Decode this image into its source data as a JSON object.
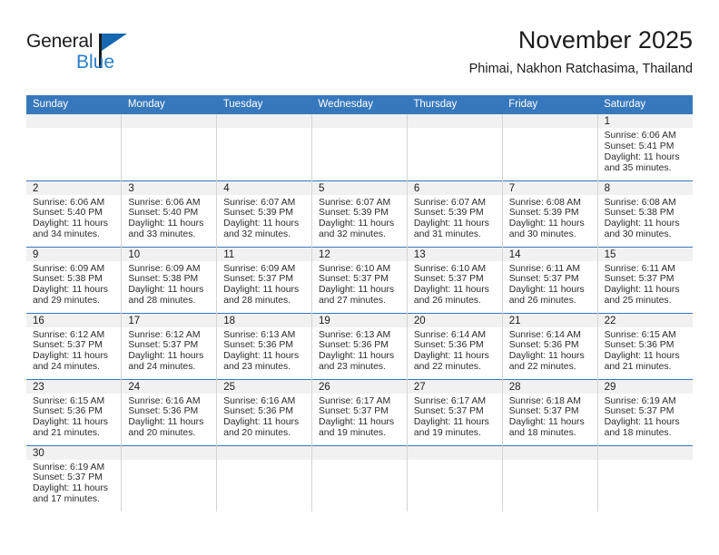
{
  "brand": {
    "name_top": "General",
    "name_bottom": "Blue",
    "accent_color": "#2a7fc9",
    "flag_color": "#1667b2"
  },
  "header": {
    "title": "November 2025",
    "subtitle": "Phimai, Nakhon Ratchasima, Thailand"
  },
  "theme": {
    "header_row_bg": "#3778bc",
    "daynum_bg": "#f1f1f1",
    "row_divider": "#3778bc",
    "col_divider": "#d4d4d4"
  },
  "weekdays": [
    "Sunday",
    "Monday",
    "Tuesday",
    "Wednesday",
    "Thursday",
    "Friday",
    "Saturday"
  ],
  "weeks": [
    [
      {
        "day": "",
        "lines": []
      },
      {
        "day": "",
        "lines": []
      },
      {
        "day": "",
        "lines": []
      },
      {
        "day": "",
        "lines": []
      },
      {
        "day": "",
        "lines": []
      },
      {
        "day": "",
        "lines": []
      },
      {
        "day": "1",
        "lines": [
          "Sunrise: 6:06 AM",
          "Sunset: 5:41 PM",
          "Daylight: 11 hours",
          "and 35 minutes."
        ]
      }
    ],
    [
      {
        "day": "2",
        "lines": [
          "Sunrise: 6:06 AM",
          "Sunset: 5:40 PM",
          "Daylight: 11 hours",
          "and 34 minutes."
        ]
      },
      {
        "day": "3",
        "lines": [
          "Sunrise: 6:06 AM",
          "Sunset: 5:40 PM",
          "Daylight: 11 hours",
          "and 33 minutes."
        ]
      },
      {
        "day": "4",
        "lines": [
          "Sunrise: 6:07 AM",
          "Sunset: 5:39 PM",
          "Daylight: 11 hours",
          "and 32 minutes."
        ]
      },
      {
        "day": "5",
        "lines": [
          "Sunrise: 6:07 AM",
          "Sunset: 5:39 PM",
          "Daylight: 11 hours",
          "and 32 minutes."
        ]
      },
      {
        "day": "6",
        "lines": [
          "Sunrise: 6:07 AM",
          "Sunset: 5:39 PM",
          "Daylight: 11 hours",
          "and 31 minutes."
        ]
      },
      {
        "day": "7",
        "lines": [
          "Sunrise: 6:08 AM",
          "Sunset: 5:39 PM",
          "Daylight: 11 hours",
          "and 30 minutes."
        ]
      },
      {
        "day": "8",
        "lines": [
          "Sunrise: 6:08 AM",
          "Sunset: 5:38 PM",
          "Daylight: 11 hours",
          "and 30 minutes."
        ]
      }
    ],
    [
      {
        "day": "9",
        "lines": [
          "Sunrise: 6:09 AM",
          "Sunset: 5:38 PM",
          "Daylight: 11 hours",
          "and 29 minutes."
        ]
      },
      {
        "day": "10",
        "lines": [
          "Sunrise: 6:09 AM",
          "Sunset: 5:38 PM",
          "Daylight: 11 hours",
          "and 28 minutes."
        ]
      },
      {
        "day": "11",
        "lines": [
          "Sunrise: 6:09 AM",
          "Sunset: 5:37 PM",
          "Daylight: 11 hours",
          "and 28 minutes."
        ]
      },
      {
        "day": "12",
        "lines": [
          "Sunrise: 6:10 AM",
          "Sunset: 5:37 PM",
          "Daylight: 11 hours",
          "and 27 minutes."
        ]
      },
      {
        "day": "13",
        "lines": [
          "Sunrise: 6:10 AM",
          "Sunset: 5:37 PM",
          "Daylight: 11 hours",
          "and 26 minutes."
        ]
      },
      {
        "day": "14",
        "lines": [
          "Sunrise: 6:11 AM",
          "Sunset: 5:37 PM",
          "Daylight: 11 hours",
          "and 26 minutes."
        ]
      },
      {
        "day": "15",
        "lines": [
          "Sunrise: 6:11 AM",
          "Sunset: 5:37 PM",
          "Daylight: 11 hours",
          "and 25 minutes."
        ]
      }
    ],
    [
      {
        "day": "16",
        "lines": [
          "Sunrise: 6:12 AM",
          "Sunset: 5:37 PM",
          "Daylight: 11 hours",
          "and 24 minutes."
        ]
      },
      {
        "day": "17",
        "lines": [
          "Sunrise: 6:12 AM",
          "Sunset: 5:37 PM",
          "Daylight: 11 hours",
          "and 24 minutes."
        ]
      },
      {
        "day": "18",
        "lines": [
          "Sunrise: 6:13 AM",
          "Sunset: 5:36 PM",
          "Daylight: 11 hours",
          "and 23 minutes."
        ]
      },
      {
        "day": "19",
        "lines": [
          "Sunrise: 6:13 AM",
          "Sunset: 5:36 PM",
          "Daylight: 11 hours",
          "and 23 minutes."
        ]
      },
      {
        "day": "20",
        "lines": [
          "Sunrise: 6:14 AM",
          "Sunset: 5:36 PM",
          "Daylight: 11 hours",
          "and 22 minutes."
        ]
      },
      {
        "day": "21",
        "lines": [
          "Sunrise: 6:14 AM",
          "Sunset: 5:36 PM",
          "Daylight: 11 hours",
          "and 22 minutes."
        ]
      },
      {
        "day": "22",
        "lines": [
          "Sunrise: 6:15 AM",
          "Sunset: 5:36 PM",
          "Daylight: 11 hours",
          "and 21 minutes."
        ]
      }
    ],
    [
      {
        "day": "23",
        "lines": [
          "Sunrise: 6:15 AM",
          "Sunset: 5:36 PM",
          "Daylight: 11 hours",
          "and 21 minutes."
        ]
      },
      {
        "day": "24",
        "lines": [
          "Sunrise: 6:16 AM",
          "Sunset: 5:36 PM",
          "Daylight: 11 hours",
          "and 20 minutes."
        ]
      },
      {
        "day": "25",
        "lines": [
          "Sunrise: 6:16 AM",
          "Sunset: 5:36 PM",
          "Daylight: 11 hours",
          "and 20 minutes."
        ]
      },
      {
        "day": "26",
        "lines": [
          "Sunrise: 6:17 AM",
          "Sunset: 5:37 PM",
          "Daylight: 11 hours",
          "and 19 minutes."
        ]
      },
      {
        "day": "27",
        "lines": [
          "Sunrise: 6:17 AM",
          "Sunset: 5:37 PM",
          "Daylight: 11 hours",
          "and 19 minutes."
        ]
      },
      {
        "day": "28",
        "lines": [
          "Sunrise: 6:18 AM",
          "Sunset: 5:37 PM",
          "Daylight: 11 hours",
          "and 18 minutes."
        ]
      },
      {
        "day": "29",
        "lines": [
          "Sunrise: 6:19 AM",
          "Sunset: 5:37 PM",
          "Daylight: 11 hours",
          "and 18 minutes."
        ]
      }
    ],
    [
      {
        "day": "30",
        "lines": [
          "Sunrise: 6:19 AM",
          "Sunset: 5:37 PM",
          "Daylight: 11 hours",
          "and 17 minutes."
        ]
      },
      {
        "day": "",
        "lines": []
      },
      {
        "day": "",
        "lines": []
      },
      {
        "day": "",
        "lines": []
      },
      {
        "day": "",
        "lines": []
      },
      {
        "day": "",
        "lines": []
      },
      {
        "day": "",
        "lines": []
      }
    ]
  ]
}
